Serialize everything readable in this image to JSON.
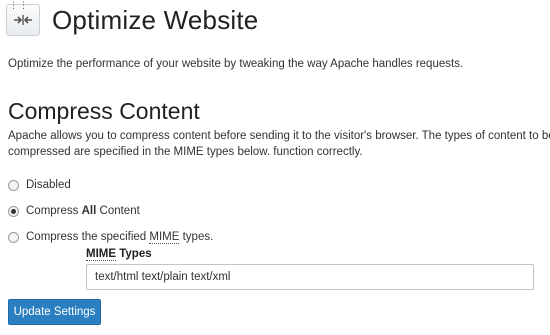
{
  "header": {
    "title": "Optimize Website",
    "icon": "compress-arrows-icon"
  },
  "description": "Optimize the performance of your website by tweaking the way Apache handles requests.",
  "section": {
    "title": "Compress Content",
    "description": "Apache allows you to compress content before sending it to the visitor's browser. The types of content to be compressed are specified in the MIME types below. function correctly."
  },
  "options": [
    {
      "label": "Disabled",
      "selected": false
    },
    {
      "label_pre": "Compress ",
      "label_bold": "All",
      "label_post": " Content",
      "selected": true
    },
    {
      "label_pre": "Compress the specified ",
      "label_abbr": "MIME",
      "label_post": " types.",
      "selected": false
    }
  ],
  "mime": {
    "label_abbr": "MIME",
    "label_rest": " Types",
    "value": "text/html text/plain text/xml"
  },
  "buttons": {
    "update": "Update Settings"
  },
  "colors": {
    "primary_button": "#2a7fc1"
  }
}
